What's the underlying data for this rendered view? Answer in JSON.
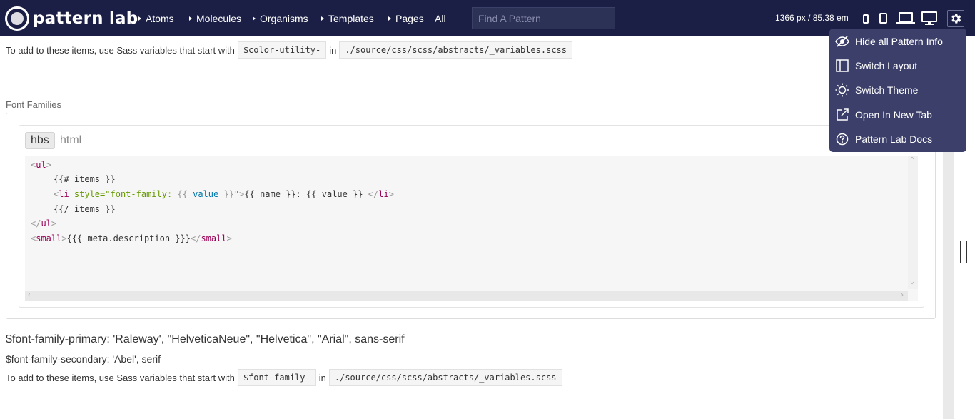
{
  "header": {
    "logo_text": "pattern lab",
    "nav": [
      {
        "label": "Atoms"
      },
      {
        "label": "Molecules"
      },
      {
        "label": "Organisms"
      },
      {
        "label": "Templates"
      },
      {
        "label": "Pages"
      }
    ],
    "all_label": "All",
    "search_placeholder": "Find A Pattern",
    "size_readout": "1366 px / 85.38 em",
    "icons": [
      "phone-small-icon",
      "phone-large-icon",
      "laptop-icon",
      "monitor-icon",
      "gear-icon"
    ],
    "background_color": "#1b1f45"
  },
  "dropdown": {
    "items": [
      {
        "label": "Hide all Pattern Info",
        "icon": "eye-slash-icon"
      },
      {
        "label": "Switch Layout",
        "icon": "layout-icon"
      },
      {
        "label": "Switch Theme",
        "icon": "sun-icon"
      },
      {
        "label": "Open In New Tab",
        "icon": "external-link-icon"
      },
      {
        "label": "Pattern Lab Docs",
        "icon": "help-icon"
      }
    ],
    "background_color": "#3b3f6a"
  },
  "color_utility": {
    "prefix_text": "To add to these items, use Sass variables that start with",
    "variable": "$color-utility-",
    "in_text": "in",
    "path": "./source/css/scss/abstracts/_variables.scss"
  },
  "font_families": {
    "heading": "Font Families",
    "tabs": [
      "hbs",
      "html"
    ],
    "code": {
      "l1_open": "<",
      "l1_tag": "ul",
      "l1_close": ">",
      "l2": "{{# items }}",
      "l3_open": "<",
      "l3_tag": "li",
      "l3_attr": " style=",
      "l3_q1": "\"font-family: ",
      "l3_m1": "{{ ",
      "l3_v1": "value",
      "l3_m2": " }}",
      "l3_q2": "\"",
      "l3_gt": ">",
      "l3_body": "{{ name }}: {{ value }} ",
      "l3_lt": "</",
      "l3_tag2": "li",
      "l3_end": ">",
      "l4": "{{/ items }}",
      "l5_open": "</",
      "l5_tag": "ul",
      "l5_close": ">",
      "l6_open": "<",
      "l6_tag": "small",
      "l6_close": ">",
      "l6_body": "{{{ meta.description }}}",
      "l6_end_open": "</",
      "l6_end_tag": "small",
      "l6_end_close": ">"
    },
    "primary": "$font-family-primary: 'Raleway', \"HelveticaNeue\", \"Helvetica\", \"Arial\", sans-serif",
    "secondary": "$font-family-secondary: 'Abel', serif",
    "prefix_text": "To add to these items, use Sass variables that start with",
    "variable": "$font-family-",
    "in_text": "in",
    "path": "./source/css/scss/abstracts/_variables.scss"
  }
}
